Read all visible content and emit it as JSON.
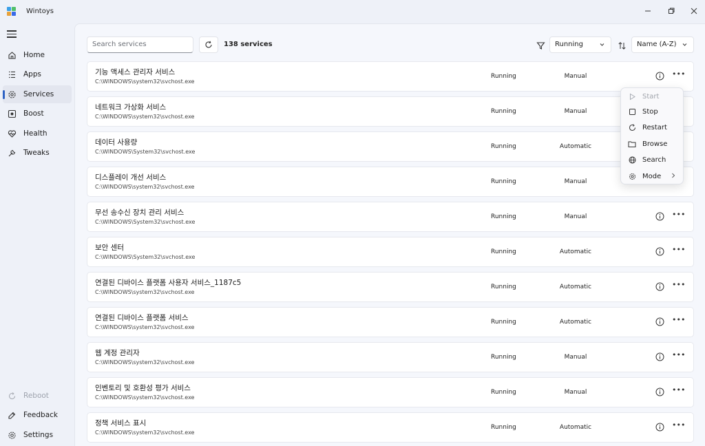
{
  "app": {
    "title": "Wintoys"
  },
  "sidebar": {
    "items": [
      {
        "label": "Home",
        "icon": "home-icon"
      },
      {
        "label": "Apps",
        "icon": "apps-icon"
      },
      {
        "label": "Services",
        "icon": "services-icon",
        "active": true
      },
      {
        "label": "Boost",
        "icon": "boost-icon"
      },
      {
        "label": "Health",
        "icon": "health-icon"
      },
      {
        "label": "Tweaks",
        "icon": "tweaks-icon"
      }
    ],
    "footer": [
      {
        "label": "Reboot",
        "icon": "reboot-icon",
        "disabled": true
      },
      {
        "label": "Feedback",
        "icon": "feedback-icon"
      },
      {
        "label": "Settings",
        "icon": "settings-icon"
      }
    ]
  },
  "toolbar": {
    "search_placeholder": "Search services",
    "count_label": "138 services",
    "filter_value": "Running",
    "sort_value": "Name (A-Z)"
  },
  "services": [
    {
      "name": "기능 액세스 관리자 서비스",
      "path": "C:\\WINDOWS\\system32\\svchost.exe",
      "status": "Running",
      "mode": "Manual"
    },
    {
      "name": "네트워크 가상화 서비스",
      "path": "C:\\WINDOWS\\system32\\svchost.exe",
      "status": "Running",
      "mode": "Manual"
    },
    {
      "name": "데이터 사용량",
      "path": "C:\\WINDOWS\\System32\\svchost.exe",
      "status": "Running",
      "mode": "Automatic"
    },
    {
      "name": "디스플레이 개선 서비스",
      "path": "C:\\WINDOWS\\system32\\svchost.exe",
      "status": "Running",
      "mode": "Manual"
    },
    {
      "name": "무선 송수신 장치 관리 서비스",
      "path": "C:\\WINDOWS\\System32\\svchost.exe",
      "status": "Running",
      "mode": "Manual"
    },
    {
      "name": "보안 센터",
      "path": "C:\\WINDOWS\\System32\\svchost.exe",
      "status": "Running",
      "mode": "Automatic"
    },
    {
      "name": "연결된 디바이스 플랫폼 사용자 서비스_1187c5",
      "path": "C:\\WINDOWS\\system32\\svchost.exe",
      "status": "Running",
      "mode": "Automatic"
    },
    {
      "name": "연결된 디바이스 플랫폼 서비스",
      "path": "C:\\WINDOWS\\system32\\svchost.exe",
      "status": "Running",
      "mode": "Automatic"
    },
    {
      "name": "웹 계정 관리자",
      "path": "C:\\WINDOWS\\system32\\svchost.exe",
      "status": "Running",
      "mode": "Manual"
    },
    {
      "name": "인벤토리 및 호환성 평가 서비스",
      "path": "C:\\WINDOWS\\system32\\svchost.exe",
      "status": "Running",
      "mode": "Manual"
    },
    {
      "name": "정책 서비스 표시",
      "path": "C:\\WINDOWS\\system32\\svchost.exe",
      "status": "Running",
      "mode": "Automatic"
    }
  ],
  "context_menu": {
    "items": [
      {
        "label": "Start",
        "icon": "play-icon",
        "disabled": true
      },
      {
        "label": "Stop",
        "icon": "stop-icon"
      },
      {
        "label": "Restart",
        "icon": "restart-icon"
      },
      {
        "label": "Browse",
        "icon": "folder-icon"
      },
      {
        "label": "Search",
        "icon": "globe-icon"
      },
      {
        "label": "Mode",
        "icon": "gear-icon",
        "submenu": true
      }
    ]
  },
  "colors": {
    "accent": "#2e62c4",
    "background": "#eef1f8",
    "card": "#ffffff"
  }
}
